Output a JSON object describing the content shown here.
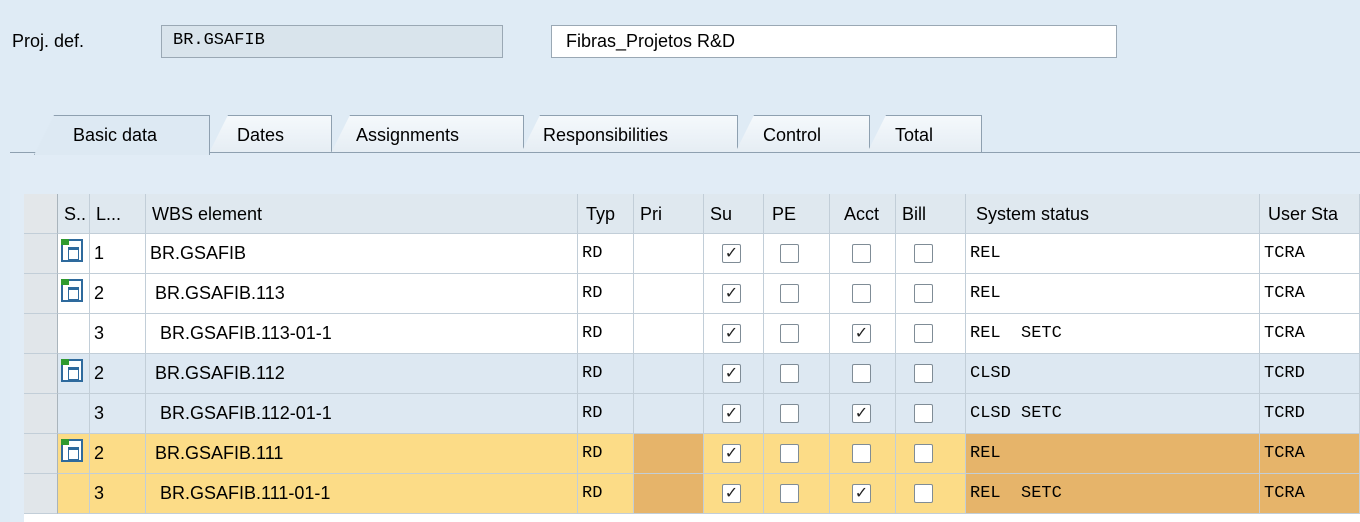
{
  "header": {
    "proj_def_label": "Proj. def.",
    "proj_def_value": "BR.GSAFIB",
    "description": "Fibras_Projetos R&D"
  },
  "tabs": [
    {
      "label": "Basic data",
      "active": true
    },
    {
      "label": "Dates"
    },
    {
      "label": "Assignments"
    },
    {
      "label": "Responsibilities"
    },
    {
      "label": "Control"
    },
    {
      "label": "Total"
    }
  ],
  "table": {
    "columns": [
      "S..",
      "L...",
      "WBS element",
      "Typ",
      "Pri",
      "Su",
      "PE",
      "Acct",
      "Bill",
      "System status",
      "User Sta"
    ],
    "rows": [
      {
        "icon": "wbs-hierarchy-icon",
        "level": "1",
        "wbs": "BR.GSAFIB",
        "typ": "RD",
        "pri": "",
        "su": "✓",
        "pe": "",
        "acct": "",
        "bill": "",
        "status": "REL",
        "user": "TCRA",
        "style": "white"
      },
      {
        "icon": "wbs-hierarchy-icon",
        "level": "2",
        "wbs": " BR.GSAFIB.113",
        "typ": "RD",
        "pri": "",
        "su": "✓",
        "pe": "",
        "acct": "",
        "bill": "",
        "status": "REL",
        "user": "TCRA",
        "style": "white"
      },
      {
        "icon": "",
        "level": "3",
        "wbs": "  BR.GSAFIB.113-01-1",
        "typ": "RD",
        "pri": "",
        "su": "✓",
        "pe": "",
        "acct": "✓",
        "bill": "",
        "status": "REL  SETC",
        "user": "TCRA",
        "style": "white"
      },
      {
        "icon": "wbs-hierarchy-icon",
        "level": "2",
        "wbs": " BR.GSAFIB.112",
        "typ": "RD",
        "pri": "",
        "su": "✓",
        "pe": "",
        "acct": "",
        "bill": "",
        "status": "CLSD",
        "user": "TCRD",
        "style": "blue"
      },
      {
        "icon": "",
        "level": "3",
        "wbs": "  BR.GSAFIB.112-01-1",
        "typ": "RD",
        "pri": "",
        "su": "✓",
        "pe": "",
        "acct": "✓",
        "bill": "",
        "status": "CLSD SETC",
        "user": "TCRD",
        "style": "blue"
      },
      {
        "icon": "wbs-hierarchy-icon",
        "level": "2",
        "wbs": " BR.GSAFIB.111",
        "typ": "RD",
        "pri": "",
        "su": "✓",
        "pe": "",
        "acct": "",
        "bill": "",
        "status": "REL",
        "user": "TCRA",
        "style": "hl"
      },
      {
        "icon": "",
        "level": "3",
        "wbs": "  BR.GSAFIB.111-01-1",
        "typ": "RD",
        "pri": "",
        "su": "✓",
        "pe": "",
        "acct": "✓",
        "bill": "",
        "status": "REL  SETC",
        "user": "TCRA",
        "style": "hl"
      }
    ]
  }
}
